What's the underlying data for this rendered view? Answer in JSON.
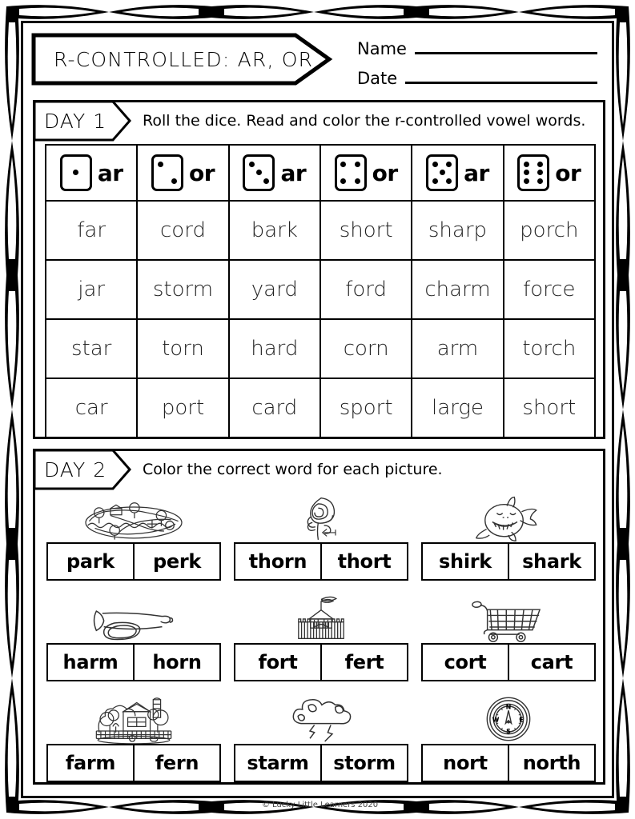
{
  "header": {
    "title": "R-CONTROLLED: AR, OR",
    "name_label": "Name",
    "date_label": "Date"
  },
  "day1": {
    "tag": "DAY 1",
    "instruction": "Roll the dice. Read and color the r-controlled vowel words.",
    "columns": [
      {
        "die": 1,
        "label": "ar"
      },
      {
        "die": 2,
        "label": "or"
      },
      {
        "die": 3,
        "label": "ar"
      },
      {
        "die": 4,
        "label": "or"
      },
      {
        "die": 5,
        "label": "ar"
      },
      {
        "die": 6,
        "label": "or"
      }
    ],
    "rows": [
      [
        "far",
        "cord",
        "bark",
        "short",
        "sharp",
        "porch"
      ],
      [
        "jar",
        "storm",
        "yard",
        "ford",
        "charm",
        "force"
      ],
      [
        "star",
        "torn",
        "hard",
        "corn",
        "arm",
        "torch"
      ],
      [
        "car",
        "port",
        "card",
        "sport",
        "large",
        "short"
      ]
    ]
  },
  "day2": {
    "tag": "DAY 2",
    "instruction": "Color the correct word for each picture.",
    "items": [
      {
        "picture": "park-picture",
        "choices": [
          "park",
          "perk"
        ]
      },
      {
        "picture": "rose-thorn-picture",
        "choices": [
          "thorn",
          "thort"
        ]
      },
      {
        "picture": "shark-picture",
        "choices": [
          "shirk",
          "shark"
        ]
      },
      {
        "picture": "horn-picture",
        "choices": [
          "harm",
          "horn"
        ]
      },
      {
        "picture": "fort-picture",
        "choices": [
          "fort",
          "fert"
        ]
      },
      {
        "picture": "shopping-cart-picture",
        "choices": [
          "cort",
          "cart"
        ]
      },
      {
        "picture": "farm-picture",
        "choices": [
          "farm",
          "fern"
        ]
      },
      {
        "picture": "storm-cloud-picture",
        "choices": [
          "starm",
          "storm"
        ]
      },
      {
        "picture": "compass-picture",
        "choices": [
          "nort",
          "north"
        ]
      }
    ],
    "compass_labels": {
      "n": "N",
      "e": "E",
      "s": "S",
      "w": "W"
    }
  },
  "footer": {
    "copyright": "© Lucky Little Learners 2020"
  },
  "colors": {
    "ink": "#000000",
    "paper": "#ffffff",
    "word_ink": "#222222"
  }
}
